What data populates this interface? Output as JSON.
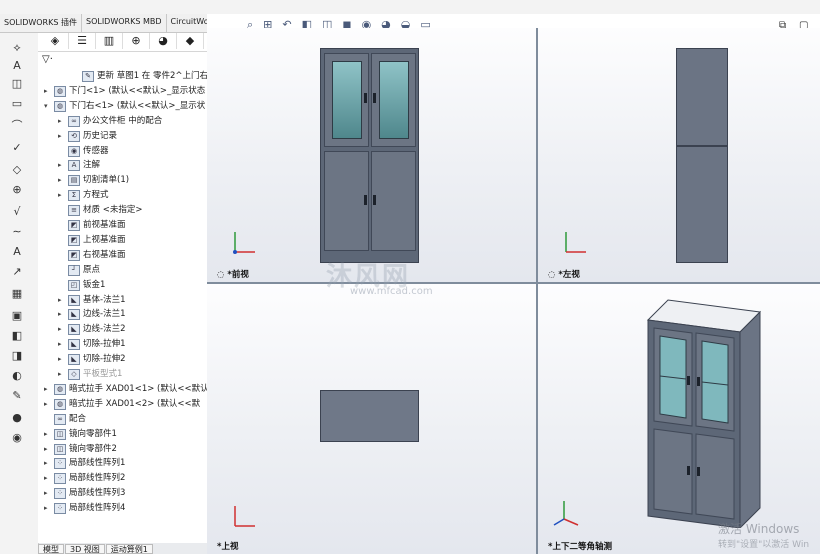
{
  "command_tabs": [
    "SOLIDWORKS 插件",
    "SOLIDWORKS MBD",
    "CircuitWorks"
  ],
  "tree": [
    {
      "label": "更新 草图1 在 零件2^上门右",
      "level": 2,
      "icon": "sketch-icon",
      "arrow": ""
    },
    {
      "label": "下门<1> (默认<<默认>_显示状态",
      "level": 0,
      "icon": "part-icon",
      "arrow": "▸"
    },
    {
      "label": "下门右<1> (默认<<默认>_显示状",
      "level": 0,
      "icon": "part-icon",
      "arrow": "▾"
    },
    {
      "label": "办公文件柜 中的配合",
      "level": 1,
      "icon": "mates-icon",
      "arrow": "▸"
    },
    {
      "label": "历史记录",
      "level": 1,
      "icon": "history-icon",
      "arrow": "▸"
    },
    {
      "label": "传感器",
      "level": 1,
      "icon": "sensor-icon",
      "arrow": ""
    },
    {
      "label": "注解",
      "level": 1,
      "icon": "annotation-icon",
      "arrow": "▸"
    },
    {
      "label": "切割清单(1)",
      "level": 1,
      "icon": "cutlist-icon",
      "arrow": "▸"
    },
    {
      "label": "方程式",
      "level": 1,
      "icon": "equation-icon",
      "arrow": "▸"
    },
    {
      "label": "材质 <未指定>",
      "level": 1,
      "icon": "material-icon",
      "arrow": ""
    },
    {
      "label": "前视基准面",
      "level": 1,
      "icon": "plane-icon",
      "arrow": ""
    },
    {
      "label": "上视基准面",
      "level": 1,
      "icon": "plane-icon",
      "arrow": ""
    },
    {
      "label": "右视基准面",
      "level": 1,
      "icon": "plane-icon",
      "arrow": ""
    },
    {
      "label": "原点",
      "level": 1,
      "icon": "origin-icon",
      "arrow": ""
    },
    {
      "label": "钣金1",
      "level": 1,
      "icon": "sheetmetal-icon",
      "arrow": ""
    },
    {
      "label": "基体-法兰1",
      "level": 1,
      "icon": "feature-icon",
      "arrow": "▸"
    },
    {
      "label": "边线-法兰1",
      "level": 1,
      "icon": "feature-icon",
      "arrow": "▸"
    },
    {
      "label": "边线-法兰2",
      "level": 1,
      "icon": "feature-icon",
      "arrow": "▸"
    },
    {
      "label": "切除-拉伸1",
      "level": 1,
      "icon": "feature-icon",
      "arrow": "▸"
    },
    {
      "label": "切除-拉伸2",
      "level": 1,
      "icon": "feature-icon",
      "arrow": "▸"
    },
    {
      "label": "平板型式1",
      "level": 1,
      "icon": "flat-pattern-icon",
      "arrow": "▸",
      "dim": true
    },
    {
      "label": "暗式拉手 XAD01<1> (默认<<默认",
      "level": 0,
      "icon": "part-icon",
      "arrow": "▸"
    },
    {
      "label": "暗式拉手 XAD01<2> (默认<<默",
      "level": 0,
      "icon": "part-icon",
      "arrow": "▸"
    },
    {
      "label": "配合",
      "level": 0,
      "icon": "mates-icon",
      "arrow": ""
    },
    {
      "label": "镜向零部件1",
      "level": 0,
      "icon": "mirror-icon",
      "arrow": "▸"
    },
    {
      "label": "镜向零部件2",
      "level": 0,
      "icon": "mirror-icon",
      "arrow": "▸"
    },
    {
      "label": "局部线性阵列1",
      "level": 0,
      "icon": "pattern-icon",
      "arrow": "▸"
    },
    {
      "label": "局部线性阵列2",
      "level": 0,
      "icon": "pattern-icon",
      "arrow": "▸"
    },
    {
      "label": "局部线性阵列3",
      "level": 0,
      "icon": "pattern-icon",
      "arrow": "▸"
    },
    {
      "label": "局部线性阵列4",
      "level": 0,
      "icon": "pattern-icon",
      "arrow": "▸"
    }
  ],
  "bottom_tabs": [
    "模型",
    "3D 视图",
    "运动算例1"
  ],
  "views": {
    "front": "*前视",
    "left": "*左视",
    "top": "*上视",
    "iso": "*上下二等角轴测"
  },
  "watermark": {
    "brand": "沐风网",
    "url": "www.mfcad.com"
  },
  "windows_watermark": {
    "line1": "激活 Windows",
    "line2": "转到\"设置\"以激活 Win"
  }
}
